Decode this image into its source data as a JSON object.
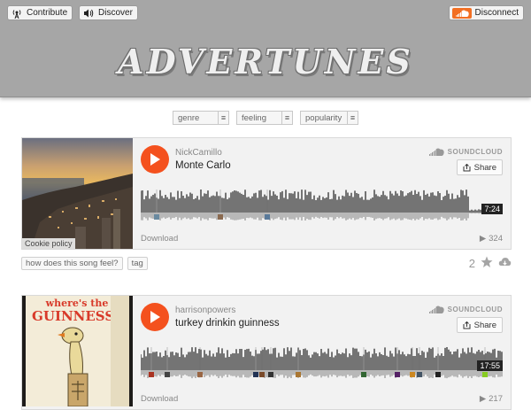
{
  "header": {
    "contribute_label": "Contribute",
    "discover_label": "Discover",
    "disconnect_label": "Disconnect",
    "logo_text": "ADVERTUNES",
    "bg_color": "#a6a6a6"
  },
  "filters": [
    {
      "label": "genre"
    },
    {
      "label": "feeling"
    },
    {
      "label": "popularity"
    }
  ],
  "tracks": [
    {
      "user": "NickCamillo",
      "title": "Monte Carlo",
      "brand": "SOUNDCLOUD",
      "share_label": "Share",
      "duration": "7:24",
      "download_label": "Download",
      "plays": "324",
      "cookie_label": "Cookie policy",
      "art": "monte-carlo-city-sunset"
    },
    {
      "user": "harrisonpowers",
      "title": "turkey drinkin guinness",
      "brand": "SOUNDCLOUD",
      "share_label": "Share",
      "duration": "17:55",
      "download_label": "Download",
      "plays": "217",
      "art_text": "where's the GUINNESS?",
      "art": "guinness-poster-bird"
    }
  ],
  "feel": {
    "prompt_label": "how does this song feel?",
    "tag_label": "tag",
    "count": "2"
  },
  "colors": {
    "accent": "#f4511e",
    "soundcloud": "#f26f23"
  }
}
